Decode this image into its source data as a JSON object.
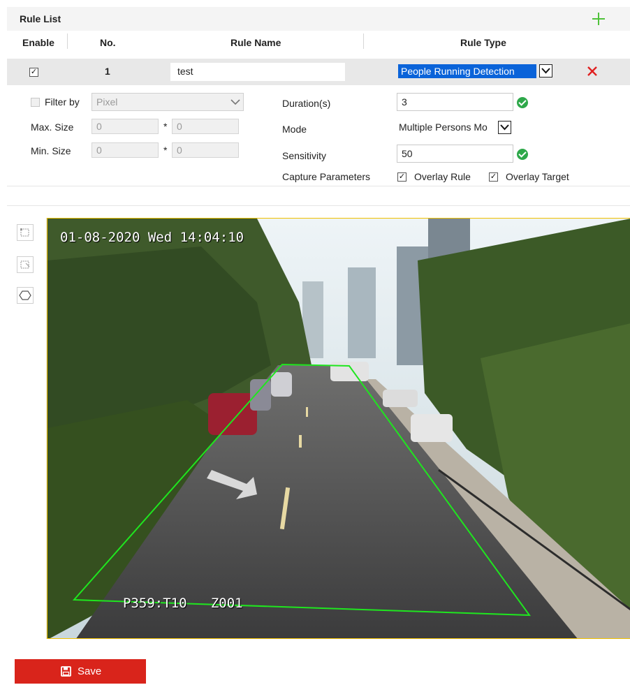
{
  "rule_list": {
    "title": "Rule List",
    "columns": {
      "enable": "Enable",
      "no": "No.",
      "rule_name": "Rule Name",
      "rule_type": "Rule Type"
    },
    "row": {
      "enabled": true,
      "no": "1",
      "name": "test",
      "rule_type": "People Running Detection"
    }
  },
  "params": {
    "filter_by_label": "Filter by",
    "filter_by_value": "Pixel",
    "max_size_label": "Max. Size",
    "max_size_w": "0",
    "max_size_h": "0",
    "min_size_label": "Min. Size",
    "min_size_w": "0",
    "min_size_h": "0",
    "times": "*",
    "duration_label": "Duration(s)",
    "duration_value": "3",
    "mode_label": "Mode",
    "mode_value": "Multiple Persons Mo",
    "sensitivity_label": "Sensitivity",
    "sensitivity_value": "50",
    "capture_label": "Capture Parameters",
    "overlay_rule_label": "Overlay Rule",
    "overlay_rule_checked": true,
    "overlay_target_label": "Overlay Target",
    "overlay_target_checked": true
  },
  "video": {
    "timestamp": "01-08-2020 Wed 14:04:10",
    "osd_bottom": "P359:T10   Z001",
    "rule_color": "#1fe61f"
  },
  "tools": [
    "draw-area-icon",
    "clear-area-icon",
    "polygon-icon"
  ],
  "save_label": "Save",
  "colors": {
    "accent_green": "#4fc23a",
    "selection_blue": "#0a63d9",
    "danger_red": "#e02020",
    "save_red": "#d9241b"
  }
}
